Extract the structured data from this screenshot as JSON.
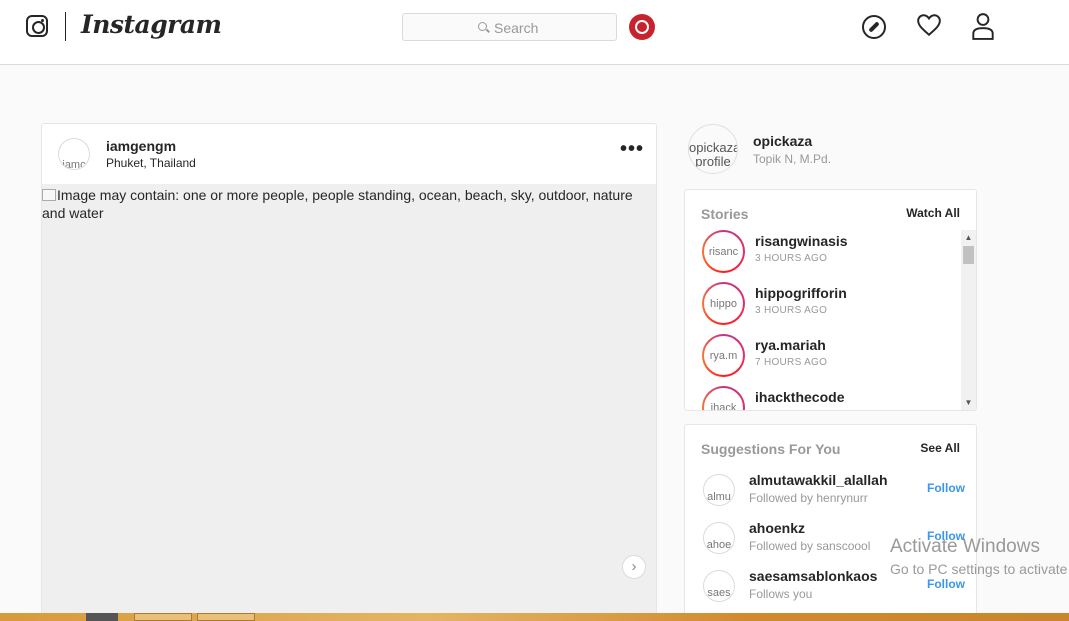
{
  "header": {
    "brand": "Instagram",
    "search_placeholder": "Search"
  },
  "post": {
    "username": "iamgengm",
    "location": "Phuket, Thailand",
    "avatar_alt": "iamc",
    "more_label": "•••",
    "image_alt": "Image may contain: one or more people, people standing, ocean, beach, sky, outdoor, nature and water",
    "next_label": "›"
  },
  "profile": {
    "avatar_alt": "opickaza profile",
    "username": "opickaza",
    "name": "Topik N, M.Pd."
  },
  "stories": {
    "title": "Stories",
    "watch_all": "Watch All",
    "items": [
      {
        "name": "risangwinasis",
        "time": "3 HOURS AGO",
        "alt": "risanc"
      },
      {
        "name": "hippogrifforin",
        "time": "3 HOURS AGO",
        "alt": "hippo"
      },
      {
        "name": "rya.mariah",
        "time": "7 HOURS AGO",
        "alt": "rya.m"
      },
      {
        "name": "ihackthecode",
        "time": "",
        "alt": "ihack"
      }
    ]
  },
  "suggestions": {
    "title": "Suggestions For You",
    "see_all": "See All",
    "items": [
      {
        "name": "almutawakkil_alallah",
        "sub": "Followed by henrynurr",
        "alt": "almu",
        "follow": "Follow"
      },
      {
        "name": "ahoenkz",
        "sub": "Followed by sanscoool",
        "alt": "ahoe",
        "follow": "Follow"
      },
      {
        "name": "saesamsablonkaos",
        "sub": "Follows you",
        "alt": "saes",
        "follow": "Follow"
      }
    ]
  },
  "watermark": {
    "title": "Activate Windows",
    "subtitle": "Go to PC settings to activate"
  },
  "colors": {
    "link_blue": "#3897f0",
    "story_ring": "#e1306c",
    "ext_red": "#c8232c"
  },
  "icons": [
    "instagram-glyph-icon",
    "search-icon",
    "extension-icon",
    "compass-icon",
    "heart-icon",
    "user-icon",
    "more-options-icon",
    "chevron-right-icon"
  ]
}
